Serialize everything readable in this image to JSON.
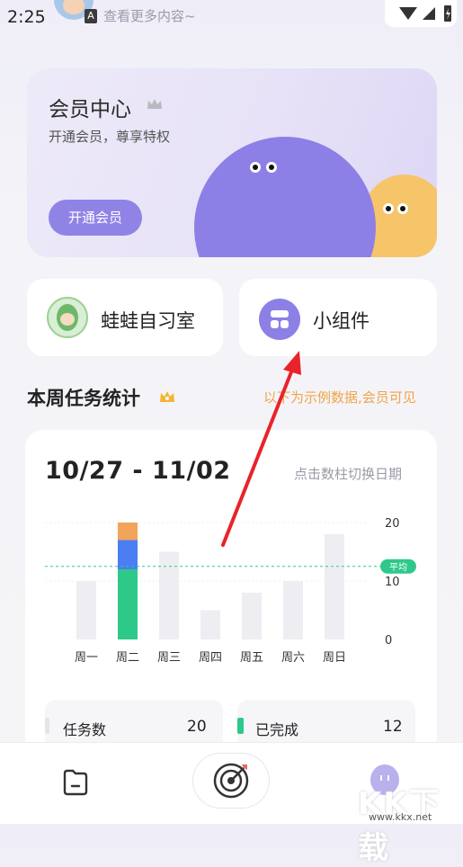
{
  "status_bar": {
    "time": "2:25",
    "more_content": "查看更多内容~",
    "badge": "A"
  },
  "member_card": {
    "title": "会员中心",
    "subtitle": "开通会员，尊享特权",
    "button": "开通会员"
  },
  "quick_cards": [
    {
      "label": "蛙蛙自习室"
    },
    {
      "label": "小组件"
    }
  ],
  "section": {
    "title": "本周任务统计",
    "note": "以下为示例数据,会员可见"
  },
  "stats": {
    "date_range": "10/27 - 11/02",
    "switch_hint": "点击数柱切换日期",
    "summary": [
      {
        "label": "任务数",
        "value": "20"
      },
      {
        "label": "已完成",
        "value": "12"
      }
    ]
  },
  "chart_data": {
    "type": "bar",
    "categories": [
      "周一",
      "周二",
      "周三",
      "周四",
      "周五",
      "周六",
      "周日"
    ],
    "values": [
      10,
      20,
      15,
      5,
      8,
      10,
      18
    ],
    "stacked_day": {
      "category": "周二",
      "segments": [
        {
          "value": 12,
          "color": "#2ec98a"
        },
        {
          "value": 5,
          "color": "#4c7ef3"
        },
        {
          "value": 3,
          "color": "#f2a45a"
        }
      ]
    },
    "ylim": [
      0,
      20
    ],
    "yticks": [
      "0",
      "10",
      "20"
    ],
    "average": 12.5,
    "average_label": "平均",
    "colors": {
      "bar": "#eeeef2",
      "average": "#2ec98a"
    }
  },
  "watermark": {
    "text": "KK下载",
    "url": "www.kkx.net"
  },
  "colors": {
    "accent": "#8c80e6",
    "note": "#f0a44a",
    "done": "#2ec98a"
  }
}
